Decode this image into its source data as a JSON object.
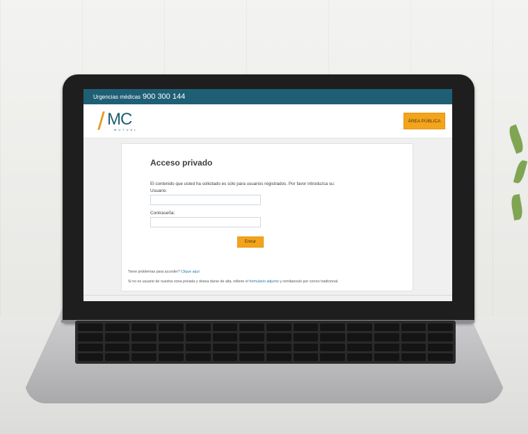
{
  "topbar": {
    "label": "Urgencias médicas",
    "phone": "900 300 144"
  },
  "header": {
    "logo_text": "MC",
    "logo_subtext": "MUTUAL",
    "area_button": "ÁREA PÚBLICA"
  },
  "login": {
    "title": "Acceso privado",
    "intro": "El contenido que usted ha solicitado es sólo para usuarios registrados. Por favor introduzca su:",
    "user_label": "Usuario:",
    "user_value": "",
    "password_label": "Contraseña:",
    "password_value": "",
    "submit": "Entrar"
  },
  "help": {
    "problem_text": "Tiene problemas para acceder?",
    "problem_link": "Clique aquí",
    "register_prefix": "Si no es usuario de nuestra zona privada y desea darse de alta, rellene el",
    "register_link": "formulario adjunto",
    "register_suffix": "y remítanoslo por correo tradicional."
  },
  "colors": {
    "brand_teal": "#1e5f75",
    "accent_orange": "#f4a41c",
    "link_blue": "#1e7aa8"
  }
}
